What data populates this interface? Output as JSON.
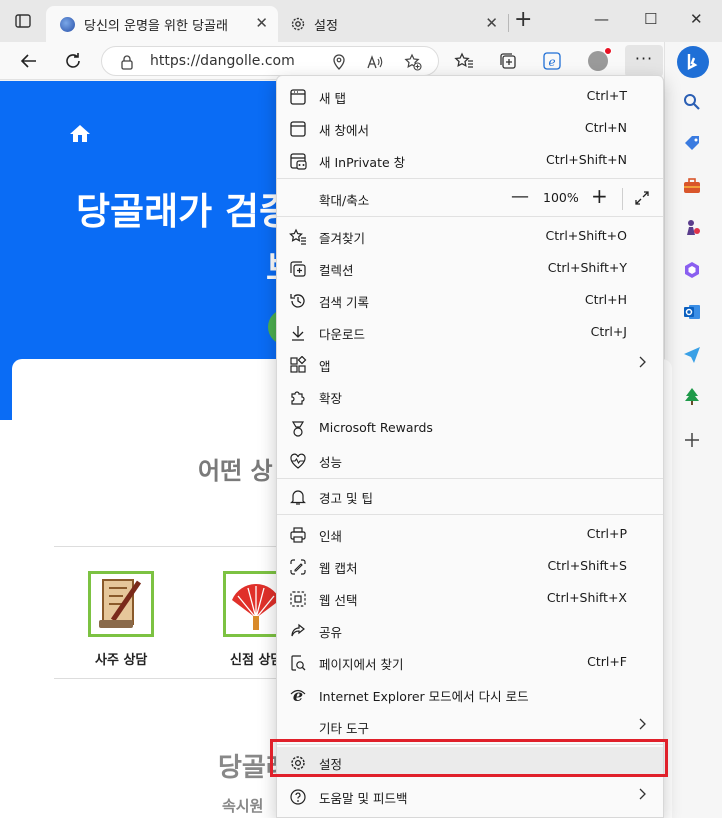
{
  "tabs": [
    {
      "title": "당신의 운명을 위한 당골래",
      "close": "✕"
    },
    {
      "title": "설정",
      "close": "✕"
    }
  ],
  "window_controls": {
    "minimize": "—",
    "maximize": "☐",
    "close": "✕"
  },
  "address_bar": {
    "url": "https://dangolle.com"
  },
  "toolbar": {
    "more_label": "···"
  },
  "page": {
    "headline": "당골래가 검증",
    "headline2": "브",
    "question_title": "어떤 상",
    "services": [
      {
        "label": "사주 상담"
      },
      {
        "label": "신점 상담"
      }
    ],
    "bottom_title": "당골래",
    "bottom_sub": "속시원"
  },
  "menu": {
    "items_top": [
      {
        "label": "새 탭",
        "shortcut": "Ctrl+T",
        "icon": "new-tab-icon"
      },
      {
        "label": "새 창에서",
        "shortcut": "Ctrl+N",
        "icon": "new-window-icon"
      },
      {
        "label": "새 InPrivate 창",
        "shortcut": "Ctrl+Shift+N",
        "icon": "inprivate-icon"
      }
    ],
    "zoom": {
      "label": "확대/축소",
      "minus": "—",
      "value": "100%",
      "plus": "+"
    },
    "items_mid": [
      {
        "label": "즐겨찾기",
        "shortcut": "Ctrl+Shift+O",
        "icon": "favorites-icon"
      },
      {
        "label": "컬렉션",
        "shortcut": "Ctrl+Shift+Y",
        "icon": "collections-icon"
      },
      {
        "label": "검색 기록",
        "shortcut": "Ctrl+H",
        "icon": "history-icon"
      },
      {
        "label": "다운로드",
        "shortcut": "Ctrl+J",
        "icon": "download-icon"
      },
      {
        "label": "앱",
        "shortcut": "",
        "icon": "apps-icon"
      },
      {
        "label": "확장",
        "shortcut": "",
        "icon": "extensions-icon"
      },
      {
        "label": "Microsoft Rewards",
        "shortcut": "",
        "icon": "rewards-icon"
      },
      {
        "label": "성능",
        "shortcut": "",
        "icon": "performance-icon"
      }
    ],
    "alerts": {
      "label": "경고 및 팁"
    },
    "items_tools": [
      {
        "label": "인쇄",
        "shortcut": "Ctrl+P",
        "icon": "print-icon"
      },
      {
        "label": "웹 캡처",
        "shortcut": "Ctrl+Shift+S",
        "icon": "web-capture-icon"
      },
      {
        "label": "웹 선택",
        "shortcut": "Ctrl+Shift+X",
        "icon": "web-select-icon"
      },
      {
        "label": "공유",
        "shortcut": "",
        "icon": "share-icon"
      },
      {
        "label": "페이지에서 찾기",
        "shortcut": "Ctrl+F",
        "icon": "find-icon"
      },
      {
        "label": "Internet Explorer 모드에서 다시 로드",
        "shortcut": "",
        "icon": "ie-mode-icon"
      },
      {
        "label": "기타 도구",
        "shortcut": "",
        "icon": ""
      }
    ],
    "settings": {
      "label": "설정"
    },
    "help": {
      "label": "도움말 및 피드백"
    }
  },
  "colors": {
    "hero": "#0a6cf5",
    "highlight_box": "#e0202a",
    "service_border": "#7cc242"
  }
}
